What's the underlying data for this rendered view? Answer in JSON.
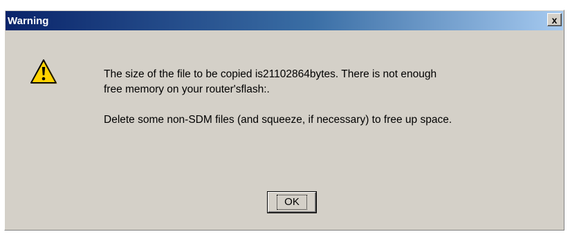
{
  "window": {
    "title": "Warning",
    "close_glyph": "x"
  },
  "icon": {
    "name": "warning-icon",
    "fill": "#ffd200",
    "stroke": "#000000",
    "mark": "!"
  },
  "message": {
    "line1": "The size of the file to be copied is21102864bytes. There is not enough",
    "line2": "free memory on your router'sflash:.",
    "line3": "Delete some non-SDM files (and squeeze, if necessary) to free up space."
  },
  "buttons": {
    "ok_label": "OK"
  }
}
